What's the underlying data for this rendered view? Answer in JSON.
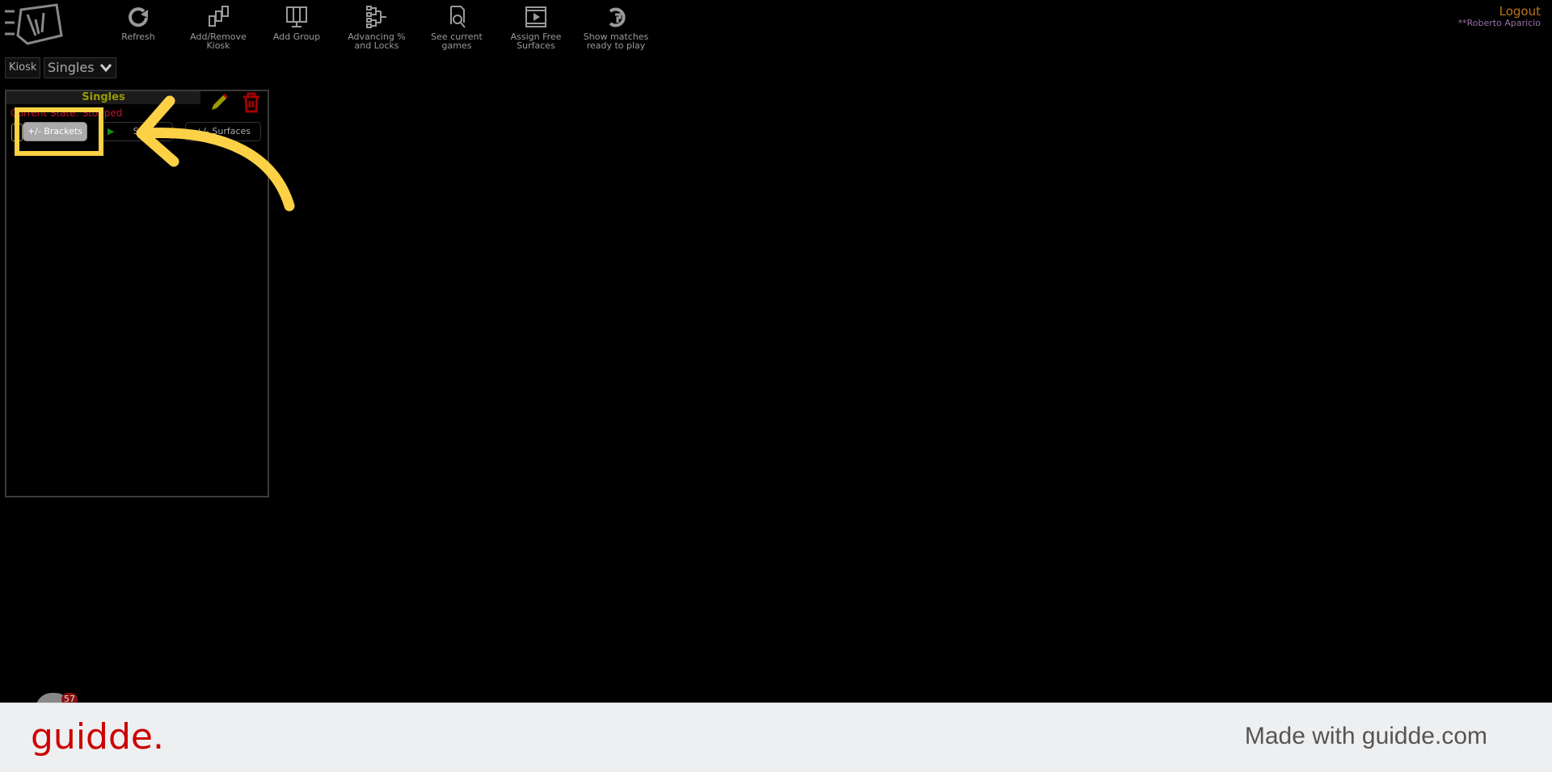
{
  "toolbar": {
    "items": [
      {
        "label": "Refresh",
        "icon": "refresh-icon"
      },
      {
        "label": "Add/Remove Kiosk",
        "icon": "kiosk-icon"
      },
      {
        "label": "Add Group",
        "icon": "group-icon"
      },
      {
        "label": "Advancing % and Locks",
        "icon": "bracket-icon"
      },
      {
        "label": "See current games",
        "icon": "search-document-icon"
      },
      {
        "label": "Assign Free Surfaces",
        "icon": "film-icon"
      },
      {
        "label": "Show matches ready to play",
        "icon": "ready-icon"
      }
    ]
  },
  "user": {
    "logout": "Logout",
    "name": "**Roberto Aparicio"
  },
  "kiosk": {
    "label": "Kiosk",
    "selected": "Singles"
  },
  "group": {
    "title": "Singles",
    "state": "Current State: Stopped",
    "buttons": {
      "brackets": "+/- Brackets",
      "start": "Start",
      "surfaces": "+/- Surfaces"
    }
  },
  "badge": "57",
  "colors": {
    "highlight": "#fdd145",
    "title": "#9a9a00",
    "state": "#c8102e",
    "brand": "#cc0000"
  },
  "footer": {
    "brand": "guidde.",
    "tagline": "Made with guidde.com"
  }
}
